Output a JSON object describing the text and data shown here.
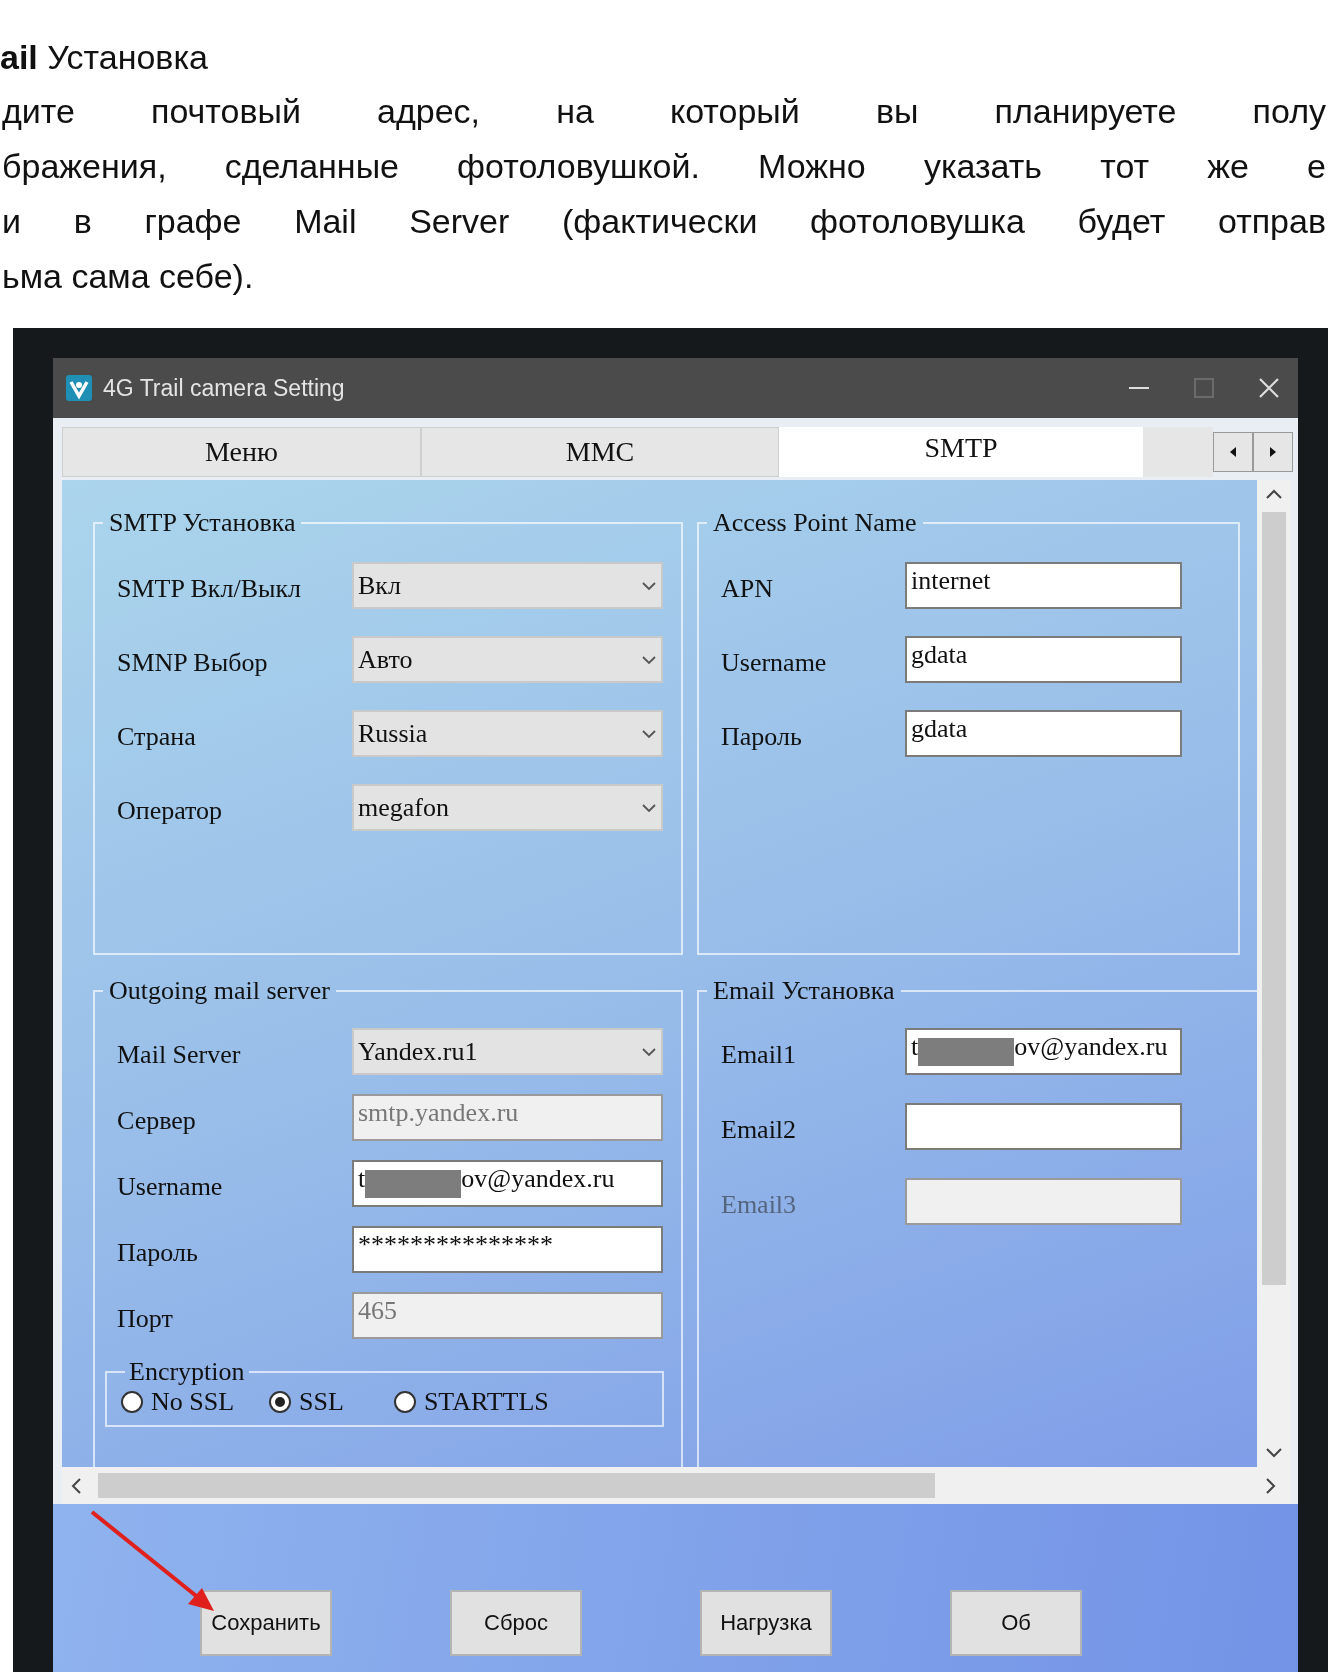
{
  "document": {
    "heading": "**ail** Установка",
    "lines": [
      "дите почтовый адрес, на который вы планируете полу",
      "бражения, сделанные фотоловушкой. Можно указать тот же е",
      "и в графе Mail Server (фактически фотоловушка будет отправ",
      "ьма сама себе)."
    ]
  },
  "window": {
    "title": "4G Trail camera Setting"
  },
  "tabs": [
    {
      "label": "Меню",
      "selected": false
    },
    {
      "label": "MMC",
      "selected": false
    },
    {
      "label": "SMTP",
      "selected": true
    }
  ],
  "groups": [
    {
      "title": "SMTP Установка",
      "rows": [
        {
          "label": "SMTP Вкл/Выкл",
          "label_disabled": false,
          "kind": "dropdown",
          "value": "Вкл",
          "disabled": false
        },
        {
          "label": "SMNP Выбор",
          "label_disabled": false,
          "kind": "dropdown",
          "value": "Авто",
          "disabled": false
        },
        {
          "label": "Страна",
          "label_disabled": false,
          "kind": "dropdown",
          "value": "Russia",
          "disabled": false
        },
        {
          "label": "Оператор",
          "label_disabled": false,
          "kind": "dropdown",
          "value": "megafon",
          "disabled": false
        }
      ]
    },
    {
      "title": "Access Point Name",
      "rows": [
        {
          "label": "APN",
          "label_disabled": false,
          "kind": "text",
          "value": "internet",
          "disabled": false
        },
        {
          "label": "Username",
          "label_disabled": false,
          "kind": "text",
          "value": "gdata",
          "disabled": false
        },
        {
          "label": "Пароль",
          "label_disabled": false,
          "kind": "text",
          "value": "gdata",
          "disabled": false
        }
      ]
    },
    {
      "title": "Outgoing mail server",
      "rows": [
        {
          "label": "Mail Server",
          "label_disabled": false,
          "kind": "dropdown",
          "value": "Yandex.ru1",
          "disabled": false
        },
        {
          "label": "Сервер",
          "label_disabled": false,
          "kind": "text",
          "value": "smtp.yandex.ru",
          "disabled": true
        },
        {
          "label": "Username",
          "label_disabled": false,
          "kind": "text",
          "value": "t",
          "redacted": true,
          "value_end": "ov@yandex.ru",
          "disabled": false
        },
        {
          "label": "Пароль",
          "label_disabled": false,
          "kind": "text",
          "value": "***************",
          "disabled": false
        },
        {
          "label": "Порт",
          "label_disabled": false,
          "kind": "text",
          "value": "465",
          "disabled": true
        }
      ],
      "encryption": {
        "title": "Encryption",
        "options": [
          {
            "label": "No SSL",
            "selected": false
          },
          {
            "label": "SSL",
            "selected": true
          },
          {
            "label": "STARTTLS",
            "selected": false
          }
        ]
      }
    },
    {
      "title": "Email Установка",
      "rows": [
        {
          "label": "Email1",
          "label_disabled": false,
          "kind": "text",
          "value": "t",
          "redacted": true,
          "value_end": "ov@yandex.ru",
          "disabled": false
        },
        {
          "label": "Email2",
          "label_disabled": false,
          "kind": "text",
          "disabled": false
        },
        {
          "label": "Email3",
          "label_disabled": true,
          "kind": "text",
          "disabled": true
        }
      ]
    }
  ],
  "buttons": [
    "Сохранить",
    "Сброс",
    "Нагрузка",
    "Об"
  ]
}
